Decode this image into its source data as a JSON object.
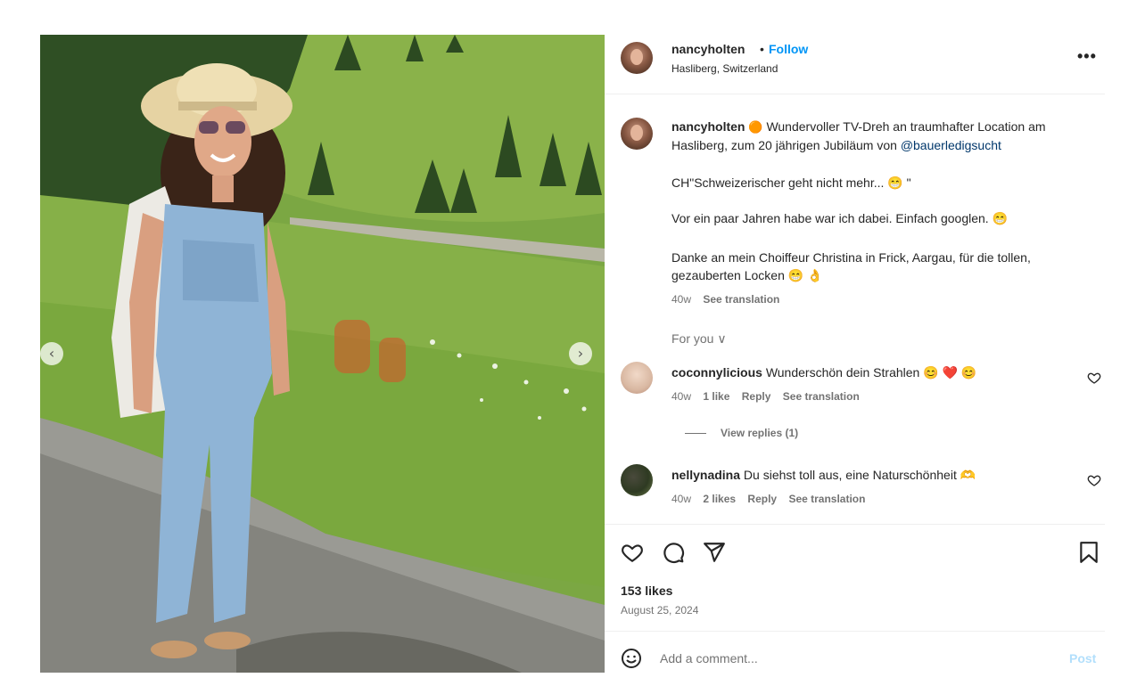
{
  "post": {
    "username": "nancyholten",
    "separator": "•",
    "follow_label": "Follow",
    "location": "Hasliberg, Switzerland",
    "more_label": "•••"
  },
  "caption": {
    "username": "nancyholten",
    "line1_emoji": "🟠",
    "line1_text": "Wundervoller TV-Dreh an traumhafter Location am",
    "line2_text": "Hasliberg, zum 20 jährigen Jubiläum von",
    "mention": "@bauerledigsucht",
    "quote": "CH\"Schweizerischer geht nicht mehr... 😁 \"",
    "para2": "Vor ein paar Jahren habe war ich dabei. Einfach googlen. 😁",
    "para3_line1": "Danke an mein Choiffeur Christina in Frick, Aargau, für die tollen,",
    "para3_line2": "gezauberten Locken 😁 👌",
    "time": "40w",
    "see_translation": "See translation"
  },
  "for_you": "For you ∨",
  "comments": [
    {
      "username": "coconnylicious",
      "text": "Wunderschön dein Strahlen 😊 ❤️ 😊",
      "time": "40w",
      "likes": "1 like",
      "reply": "Reply",
      "see_translation": "See translation"
    },
    {
      "username": "nellynadina",
      "text": "Du siehst toll aus, eine Naturschönheit 🫶",
      "time": "40w",
      "likes": "2 likes",
      "reply": "Reply",
      "see_translation": "See translation"
    }
  ],
  "view_replies": "View replies (1)",
  "likes_count": "153 likes",
  "date": "August 25, 2024",
  "add_comment": {
    "placeholder": "Add a comment...",
    "post_label": "Post"
  },
  "icons": {
    "like": "heart-icon",
    "comment": "comment-icon",
    "share": "send-icon",
    "save": "bookmark-icon",
    "emoji": "emoji-icon",
    "prev": "chevron-left-icon",
    "next": "chevron-right-icon"
  },
  "colors": {
    "accent": "#0095f6",
    "mention": "#00376b",
    "muted": "#737373",
    "post_disabled": "#b2dffc"
  }
}
